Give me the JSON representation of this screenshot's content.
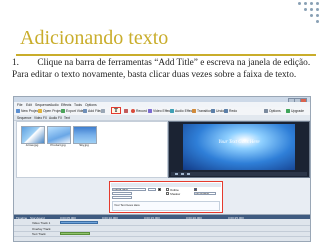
{
  "slide": {
    "title": "Adicionando texto",
    "caption_number": "1.",
    "caption": "Clique na barra de ferramentas “Add Title” e escreva na janela de edição. Para editar o texto novamente, basta clicar duas vezes sobre a faixa de texto."
  },
  "app": {
    "menu": [
      "File",
      "Edit",
      "Sequence",
      "Audio",
      "Effects",
      "Tools",
      "Options"
    ],
    "toolbar": [
      {
        "label": "New Project",
        "icon": "new-project-icon",
        "color": "#5b8fd1"
      },
      {
        "label": "Open Project",
        "icon": "open-project-icon",
        "color": "#e0b33c"
      },
      {
        "label": "Export Video",
        "icon": "export-video-icon",
        "color": "#4aa35a"
      },
      {
        "label": "Add File(s)",
        "icon": "add-files-icon",
        "color": "#6e8fb8"
      },
      {
        "label": "Add Blank",
        "icon": "add-blank-icon",
        "color": "#9aa7b6"
      },
      {
        "label": "Add Title",
        "icon": "text-t-icon",
        "color": "#222222"
      },
      {
        "label": "Split",
        "icon": "split-icon",
        "color": "#c35b5b"
      },
      {
        "label": "Record",
        "icon": "record-icon",
        "color": "#d94b3b"
      },
      {
        "label": "Video Effect",
        "icon": "video-effect-icon",
        "color": "#7a6ad0"
      },
      {
        "label": "Audio Effect",
        "icon": "audio-effect-icon",
        "color": "#3fa0b5"
      },
      {
        "label": "Transition",
        "icon": "transition-icon",
        "color": "#d08a3a"
      },
      {
        "label": "Undo",
        "icon": "undo-icon",
        "color": "#5b7fa8"
      },
      {
        "label": "Redo",
        "icon": "redo-icon",
        "color": "#5b7fa8"
      },
      {
        "label": "Options",
        "icon": "options-icon",
        "color": "#7b8a9e"
      },
      {
        "label": "Upgrade",
        "icon": "upgrade-icon",
        "color": "#3fa45a"
      }
    ],
    "tabs": [
      "Sequence",
      "Video FX",
      "Audio FX",
      "Text"
    ],
    "media_clips": [
      "Arrow.jpg",
      "Product.jpg",
      "Sky.jpg"
    ],
    "preview_text": "Your Text Goes Here",
    "editor": {
      "font_value": "Lucida Sans",
      "outline_label": "Outline",
      "shadow_label": "Shadow",
      "scroll_label": "No scrolling",
      "text_value": "Your Text Goes Here"
    },
    "timeline": {
      "tabs": [
        "Timeline",
        "Storyboard"
      ],
      "times": [
        "0:00:05.000",
        "0:00:10.000",
        "0:00:15.000",
        "0:00:20.000",
        "0:00:25.000"
      ],
      "tracks": [
        "Video Track 1",
        "Overlay Track",
        "Text Track"
      ]
    }
  }
}
